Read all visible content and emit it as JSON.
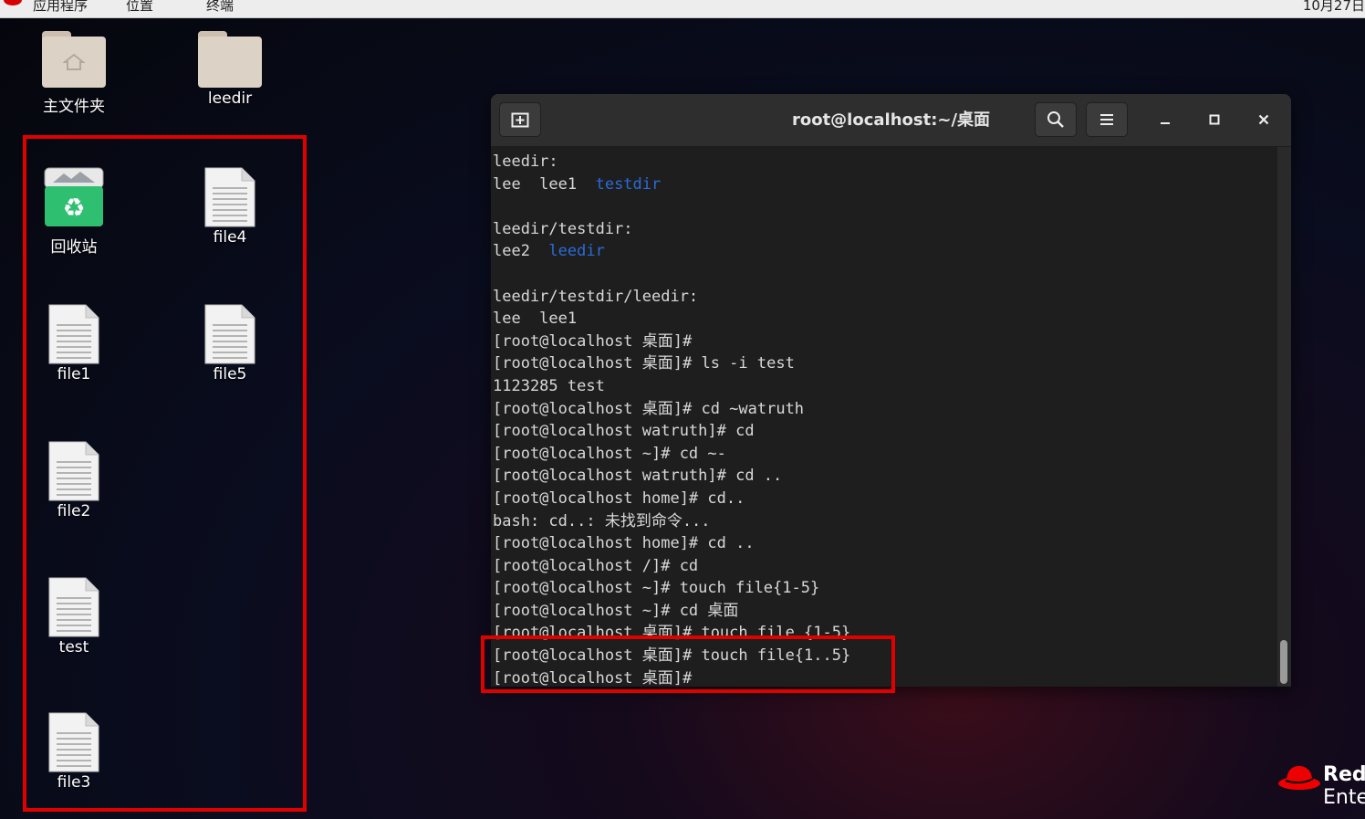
{
  "topbar": {
    "menu_apps": "应用程序",
    "menu_places": "位置",
    "menu_terminal": "终端",
    "clock": "10月27日"
  },
  "desktop": {
    "icons": {
      "home": "主文件夹",
      "leedir": "leedir",
      "trash": "回收站",
      "file4": "file4",
      "file1": "file1",
      "file5": "file5",
      "file2": "file2",
      "test": "test",
      "file3": "file3"
    }
  },
  "terminal": {
    "title": "root@localhost:~/桌面",
    "lines": [
      "leedir:",
      {
        "a": "lee  lee1  ",
        "dir": "testdir"
      },
      "",
      "leedir/testdir:",
      {
        "a": "lee2  ",
        "dir": "leedir"
      },
      "",
      "leedir/testdir/leedir:",
      "lee  lee1",
      "[root@localhost 桌面]#",
      "[root@localhost 桌面]# ls -i test",
      "1123285 test",
      "[root@localhost 桌面]# cd ~watruth",
      "[root@localhost watruth]# cd",
      "[root@localhost ~]# cd ~-",
      "[root@localhost watruth]# cd ..",
      "[root@localhost home]# cd..",
      "bash: cd..: 未找到命令...",
      "[root@localhost home]# cd ..",
      "[root@localhost /]# cd",
      "[root@localhost ~]# touch file{1-5}",
      "[root@localhost ~]# cd 桌面",
      "[root@localhost 桌面]# touch file {1-5}",
      "[root@localhost 桌面]# touch file{1..5}",
      "[root@localhost 桌面]#"
    ]
  },
  "logo": {
    "line1": "Red",
    "line2": "Ente"
  },
  "colors": {
    "highlight_box": "#e00000",
    "directory_text": "#2a6bd8",
    "terminal_bg": "#1e1e1e"
  }
}
